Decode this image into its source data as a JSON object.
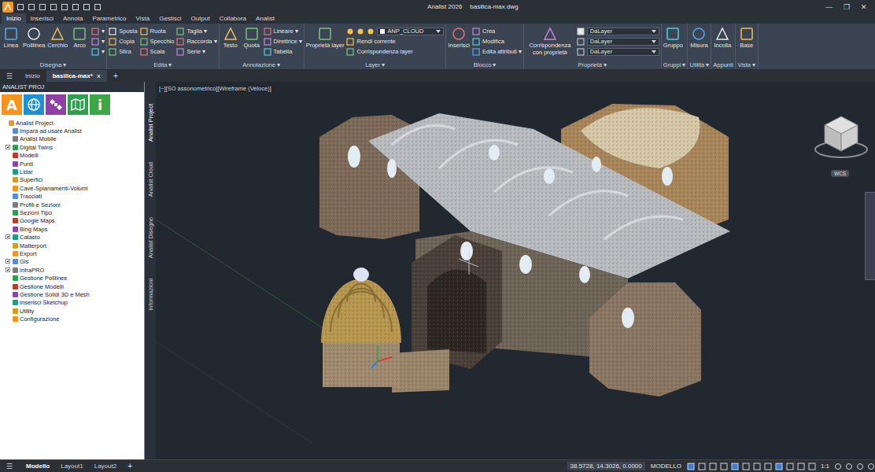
{
  "window": {
    "title": "Analist 2026",
    "file": "basilica-max.dwg",
    "controls": [
      "—",
      "❐",
      "✕"
    ]
  },
  "ribbon_tabs": [
    {
      "label": "Inizio",
      "selected": true
    },
    {
      "label": "Inserisci",
      "selected": false
    },
    {
      "label": "Annota",
      "selected": false
    },
    {
      "label": "Parametrico",
      "selected": false
    },
    {
      "label": "Vista",
      "selected": false
    },
    {
      "label": "Gestisci",
      "selected": false
    },
    {
      "label": "Output",
      "selected": false
    },
    {
      "label": "Collabora",
      "selected": false
    },
    {
      "label": "Analist",
      "selected": false
    }
  ],
  "ribbon_groups": [
    {
      "label": "Disegna ▾",
      "items": [
        {
          "kind": "large",
          "label": "Linea"
        },
        {
          "kind": "large",
          "label": "Polilinea"
        },
        {
          "kind": "large",
          "label": "Cerchio"
        },
        {
          "kind": "large",
          "label": "Arco"
        },
        {
          "kind": "stack",
          "rows": [
            "▾",
            "▾",
            "▾"
          ]
        }
      ]
    },
    {
      "label": "Edita ▾",
      "items": [
        {
          "kind": "stack",
          "rows": [
            "Sposta",
            "Copia",
            "Stira"
          ]
        },
        {
          "kind": "stack",
          "rows": [
            "Ruota",
            "Specchio",
            "Scala"
          ]
        },
        {
          "kind": "stack",
          "rows": [
            "Taglia ▾",
            "Raccorda ▾",
            "Serie ▾"
          ]
        }
      ]
    },
    {
      "label": "Annotazione ▾",
      "items": [
        {
          "kind": "large",
          "label": "Testo"
        },
        {
          "kind": "large",
          "label": "Quota"
        },
        {
          "kind": "stack",
          "rows": [
            "Lineare ▾",
            "Direttrice ▾",
            "Tabella"
          ]
        }
      ]
    },
    {
      "label": "Layer ▾",
      "items": [
        {
          "kind": "large",
          "label": "Proprietà layer"
        },
        {
          "kind": "layer",
          "value": "ANP_CLOUD",
          "rows": [
            "Rendi corrente",
            "Corrispondenza layer"
          ]
        }
      ]
    },
    {
      "label": "Blocco ▾",
      "items": [
        {
          "kind": "large",
          "label": "Inserisci"
        },
        {
          "kind": "stack",
          "rows": [
            "Crea",
            "Modifica",
            "Edita attributi ▾"
          ]
        }
      ]
    },
    {
      "label": "Proprietà ▾",
      "items": [
        {
          "kind": "large",
          "label": "Corrispondenza con proprietà"
        },
        {
          "kind": "dropdowns",
          "rows": [
            "DaLayer",
            "DaLayer",
            "DaLayer"
          ]
        }
      ]
    },
    {
      "label": "Gruppi ▾",
      "items": [
        {
          "kind": "large",
          "label": "Gruppo"
        }
      ]
    },
    {
      "label": "Utilità ▾",
      "items": [
        {
          "kind": "large",
          "label": "Misura"
        }
      ]
    },
    {
      "label": "Appunti",
      "items": [
        {
          "kind": "large",
          "label": "Incolla"
        }
      ]
    },
    {
      "label": "Vista ▾",
      "items": [
        {
          "kind": "large",
          "label": "Base"
        }
      ]
    }
  ],
  "doc_tabs": {
    "menu": "☰",
    "tabs": [
      {
        "label": "Inizio",
        "selected": false,
        "close": ""
      },
      {
        "label": "basilica-max*",
        "selected": true,
        "close": "×"
      }
    ],
    "add": "+"
  },
  "left_panel": {
    "title": "ANALIST PROJ",
    "buttons": [
      {
        "kind": "letter",
        "text": "A",
        "color": "#f7941d"
      },
      {
        "kind": "globe",
        "text": "",
        "color": "#1e90d6"
      },
      {
        "kind": "satellite",
        "text": "",
        "color": "#8e3fa8"
      },
      {
        "kind": "map",
        "text": "",
        "color": "#2e9e4f"
      },
      {
        "kind": "letter",
        "text": "i",
        "color": "#3aa845"
      }
    ],
    "tree": [
      {
        "label": "Analist Project",
        "level": 0,
        "expandable": false,
        "expanded": true
      },
      {
        "label": "Impara ad usare Analist",
        "level": 1,
        "expandable": false,
        "expanded": false
      },
      {
        "label": "Analist Mobile",
        "level": 1,
        "expandable": false,
        "expanded": false
      },
      {
        "label": "Digital Twins",
        "level": 1,
        "expandable": true,
        "expanded": false
      },
      {
        "label": "Modelli",
        "level": 1,
        "expandable": false,
        "expanded": false
      },
      {
        "label": "Punti",
        "level": 1,
        "expandable": false,
        "expanded": false
      },
      {
        "label": "Lidar",
        "level": 1,
        "expandable": false,
        "expanded": false
      },
      {
        "label": "Superfici",
        "level": 1,
        "expandable": false,
        "expanded": false
      },
      {
        "label": "Cave-Spianamenti-Volumi",
        "level": 1,
        "expandable": false,
        "expanded": false
      },
      {
        "label": "Tracciati",
        "level": 1,
        "expandable": false,
        "expanded": false
      },
      {
        "label": "Profili e Sezioni",
        "level": 1,
        "expandable": false,
        "expanded": false
      },
      {
        "label": "Sezioni Tipo",
        "level": 1,
        "expandable": false,
        "expanded": false
      },
      {
        "label": "Google Maps",
        "level": 1,
        "expandable": false,
        "expanded": false
      },
      {
        "label": "Bing Maps",
        "level": 1,
        "expandable": false,
        "expanded": false
      },
      {
        "label": "Catasto",
        "level": 1,
        "expandable": true,
        "expanded": false
      },
      {
        "label": "Matterport",
        "level": 1,
        "expandable": false,
        "expanded": false
      },
      {
        "label": "Export",
        "level": 1,
        "expandable": false,
        "expanded": false
      },
      {
        "label": "Gis",
        "level": 1,
        "expandable": true,
        "expanded": false
      },
      {
        "label": "InfraPRO",
        "level": 1,
        "expandable": true,
        "expanded": false
      },
      {
        "label": "Gestione Polilinee",
        "level": 1,
        "expandable": false,
        "expanded": false
      },
      {
        "label": "Gestione Modelli",
        "level": 1,
        "expandable": false,
        "expanded": false
      },
      {
        "label": "Gestione Solidi 3D e Mesh",
        "level": 1,
        "expandable": false,
        "expanded": false
      },
      {
        "label": "Inserisci Sketchup",
        "level": 1,
        "expandable": false,
        "expanded": false
      },
      {
        "label": "Utility",
        "level": 1,
        "expandable": false,
        "expanded": false
      },
      {
        "label": "Configurazione",
        "level": 1,
        "expandable": false,
        "expanded": false
      }
    ]
  },
  "side_tabs": [
    {
      "label": "Analist Project",
      "selected": true
    },
    {
      "label": "Analist Cloud",
      "selected": false
    },
    {
      "label": "Analist Disegno",
      "selected": false
    },
    {
      "label": "Informazioni",
      "selected": false
    }
  ],
  "viewport": {
    "label": "[−][SO assonometrico][Wireframe (Veloce)]",
    "ucs_label": "WCS"
  },
  "status_bar": {
    "menu": "☰",
    "tabs": [
      {
        "label": "Modello",
        "selected": true
      },
      {
        "label": "Layout1",
        "selected": false
      },
      {
        "label": "Layout2",
        "selected": false
      }
    ],
    "add": "+",
    "coords": "38.5728, 14.3026, 0.0000",
    "mode": "MODELLO",
    "scale": "1:1"
  }
}
